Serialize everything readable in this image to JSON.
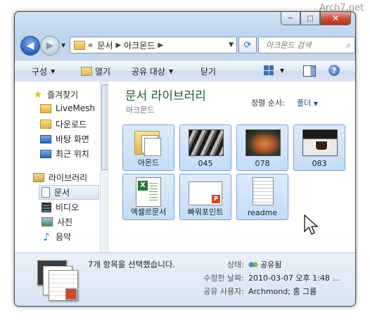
{
  "watermark": "Arch7.net",
  "window": {
    "caption_buttons": {
      "minimize": "─",
      "maximize": "□",
      "close": "✕"
    },
    "address": {
      "crumbs": [
        "문서",
        "아크몬드"
      ],
      "prefix": "«"
    },
    "search": {
      "placeholder": "아크몬드 검색"
    }
  },
  "toolbar": {
    "organize": "구성",
    "open": "열기",
    "share": "공유 대상",
    "close": "닫기"
  },
  "sidebar": {
    "items": [
      {
        "label": "즐겨찾기",
        "icon": "star-icon"
      },
      {
        "label": "LiveMesh",
        "icon": "folder-icon"
      },
      {
        "label": "다운로드",
        "icon": "folder-icon"
      },
      {
        "label": "바탕 화면",
        "icon": "desktop-icon"
      },
      {
        "label": "최근 위치",
        "icon": "recent-places-icon"
      },
      {
        "label": "라이브러리",
        "icon": "library-icon"
      },
      {
        "label": "문서",
        "icon": "documents-icon"
      },
      {
        "label": "비디오",
        "icon": "videos-icon"
      },
      {
        "label": "사진",
        "icon": "pictures-icon"
      },
      {
        "label": "음악",
        "icon": "music-icon"
      }
    ]
  },
  "main": {
    "title": "문서 라이브러리",
    "subtitle": "아크몬드",
    "sort_label": "정렬 순서:",
    "sort_value": "폴더",
    "items": [
      {
        "label": "아몬드",
        "kind": "folder"
      },
      {
        "label": "045",
        "kind": "photo"
      },
      {
        "label": "078",
        "kind": "photo"
      },
      {
        "label": "083",
        "kind": "photo"
      },
      {
        "label": "엑셀르문서",
        "kind": "excel"
      },
      {
        "label": "빠워포인트",
        "kind": "powerpoint"
      },
      {
        "label": "readme",
        "kind": "text"
      }
    ]
  },
  "details": {
    "count_text": "7개 항목을 선택했습니다.",
    "state_key": "상태:",
    "state_value": "공유됨",
    "modified_key": "수정한 날짜:",
    "modified_value": "2010-03-07 오후 1:48 ...",
    "shared_key": "공유 사용자:",
    "shared_value": "Archmond; 홈 그룹"
  }
}
